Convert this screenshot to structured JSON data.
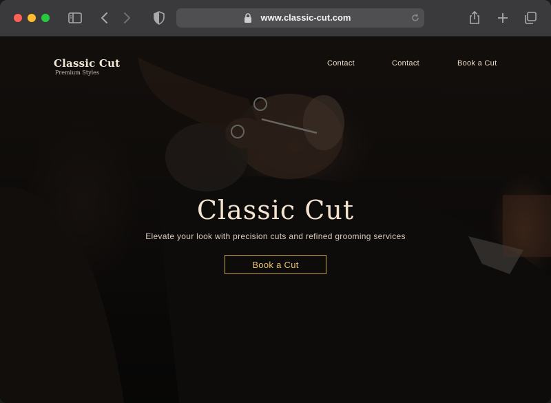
{
  "browser": {
    "url": "www.classic-cut.com",
    "icons": {
      "sidebar": "sidebar-icon",
      "back": "chevron-left-icon",
      "forward": "chevron-right-icon",
      "privacy": "shield-icon",
      "lock": "lock-icon",
      "reload": "reload-icon",
      "share": "share-icon",
      "new_tab": "plus-icon",
      "tabs": "tabs-overview-icon"
    }
  },
  "site": {
    "brand": {
      "title": "Classic Cut",
      "subtitle": "Premium Styles"
    },
    "nav": [
      {
        "label": "Contact"
      },
      {
        "label": "Contact"
      },
      {
        "label": "Book a Cut"
      }
    ],
    "hero": {
      "title": "Classic Cut",
      "subtitle": "Elevate your look with precision cuts and refined grooming services",
      "cta_label": "Book a Cut"
    },
    "colors": {
      "accent_gold": "#c9a24a",
      "cta_text": "#e9c36a",
      "heading": "#f3e3cf",
      "background": "#0c0b0a"
    }
  }
}
